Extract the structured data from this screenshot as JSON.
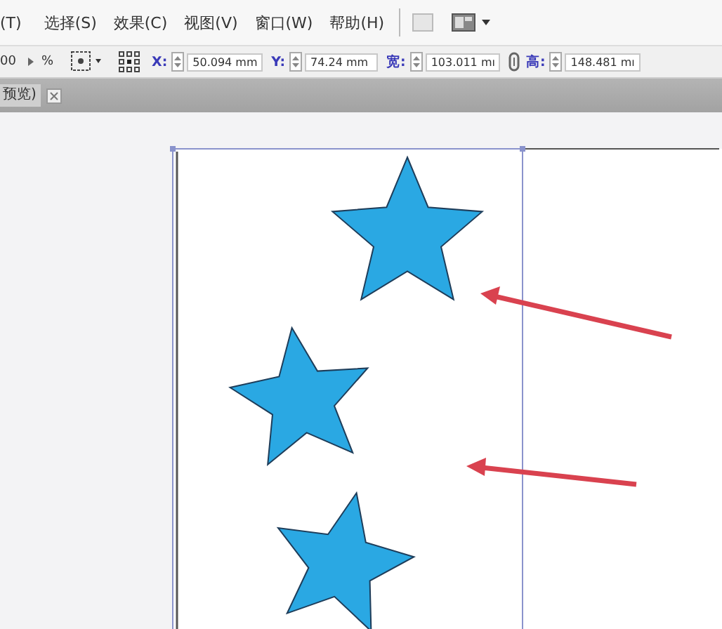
{
  "menu": [
    "(T)",
    "选择(S)",
    "效果(C)",
    "视图(V)",
    "窗口(W)",
    "帮助(H)"
  ],
  "toolbar": {
    "zoom": "00",
    "percent": "%",
    "fields": [
      {
        "label": "X:",
        "value": "50.094 mm"
      },
      {
        "label": "Y:",
        "value": "74.24 mm"
      },
      {
        "label": "宽:",
        "value": "103.011 mı"
      },
      {
        "label": "高:",
        "value": "148.481 mı"
      }
    ]
  },
  "tab": {
    "label": "预览)"
  }
}
